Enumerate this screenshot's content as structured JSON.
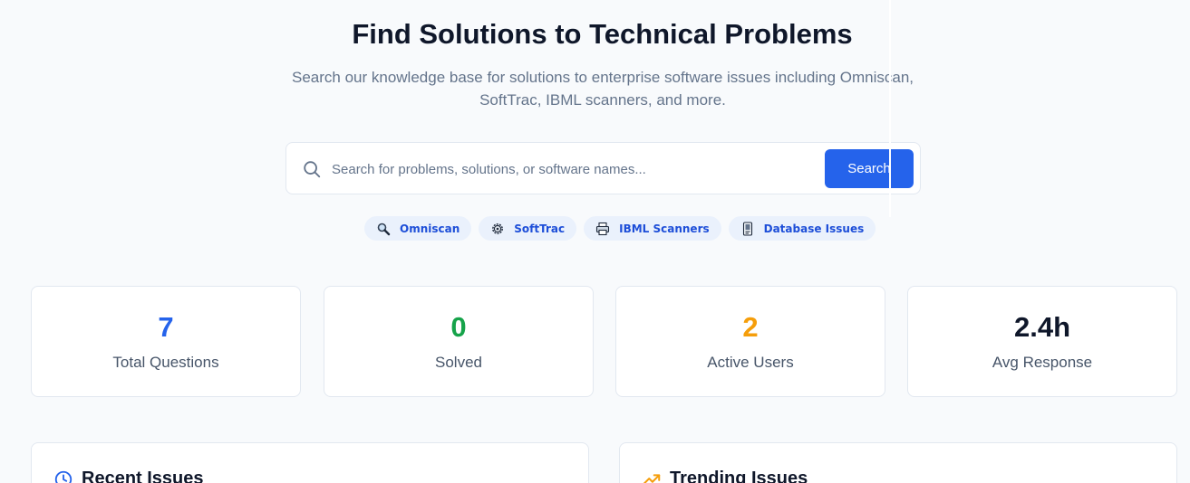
{
  "hero": {
    "title": "Find Solutions to Technical Problems",
    "subtitle_line1": "Search our knowledge base for solutions to enterprise software issues including Omniscan,",
    "subtitle_line2": "SoftTrac, IBML scanners, and more."
  },
  "search": {
    "placeholder": "Search for problems, solutions, or software names...",
    "value": "",
    "button_label": "Search",
    "icon": "search-icon"
  },
  "tags": [
    {
      "label": "Omniscan",
      "icon": "magnifier-icon"
    },
    {
      "label": "SoftTrac",
      "icon": "gear-icon"
    },
    {
      "label": "IBML Scanners",
      "icon": "printer-icon"
    },
    {
      "label": "Database Issues",
      "icon": "document-icon"
    }
  ],
  "stats": [
    {
      "value": "7",
      "label": "Total Questions",
      "color": "#2563eb"
    },
    {
      "value": "0",
      "label": "Solved",
      "color": "#16a34a"
    },
    {
      "value": "2",
      "label": "Active Users",
      "color": "#f59e0b"
    },
    {
      "value": "2.4h",
      "label": "Avg Response",
      "color": "#0f172a"
    }
  ],
  "panels": {
    "recent": {
      "title": "Recent Issues",
      "icon": "clock-icon"
    },
    "trending": {
      "title": "Trending Issues",
      "icon": "trending-up-icon"
    }
  },
  "colors": {
    "accent": "#2563eb",
    "tag_bg": "#eaf1fc",
    "tag_text": "#1d4ed8"
  }
}
